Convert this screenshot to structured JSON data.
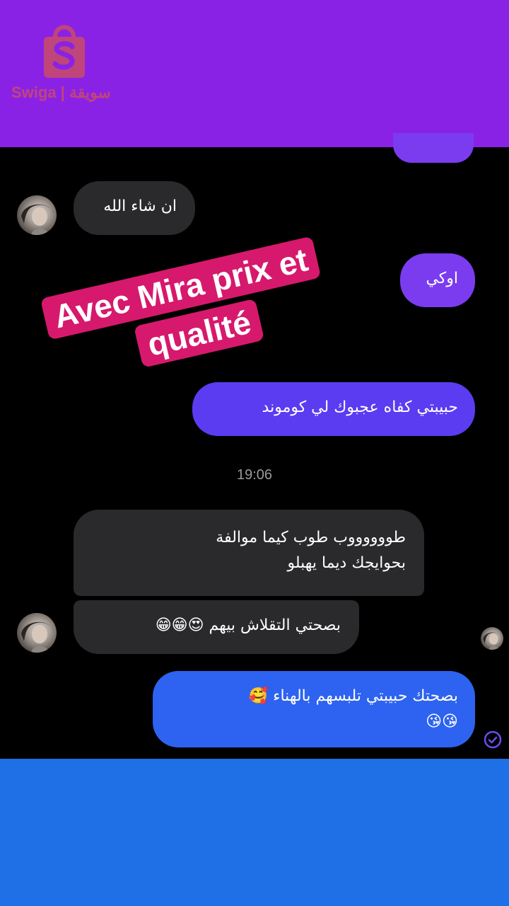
{
  "logo": {
    "text": "Swiga | سويقة",
    "color": "#c0457a"
  },
  "messages": [
    {
      "from": "sent",
      "text": ""
    },
    {
      "from": "received",
      "text": "ان شاء الله"
    },
    {
      "from": "sent",
      "text": "اوكي"
    },
    {
      "from": "sent",
      "text": "حبيبتي كفاه عجبوك لي كوموند"
    },
    {
      "from": "received",
      "lines": [
        "طووووووب طوب كيما موالفة",
        "بحوايجك ديما يهبلو"
      ]
    },
    {
      "from": "received",
      "text": "بصحتي التقلاش بيهم 😍😁😁"
    },
    {
      "from": "sent",
      "lines": [
        "بصحتك حبيبتي تلبسهم بالهناء 🥰",
        "😘😘"
      ]
    }
  ],
  "timestamp": "19:06",
  "overlay": {
    "line1": "Avec Mira prix et",
    "line2": "qualité",
    "color": "#d6196d"
  },
  "icons": {
    "avatar": "avatar",
    "seen": "check-circle-icon"
  },
  "colors": {
    "top_band": "#8a22e6",
    "bottom_band": "#1f6fe6",
    "received_bubble": "#2a2a2c",
    "sent_bubble_purple": "#7b3cf0",
    "sent_bubble_indigo": "#5b3cf0",
    "sent_bubble_blue": "#2d63f0"
  }
}
